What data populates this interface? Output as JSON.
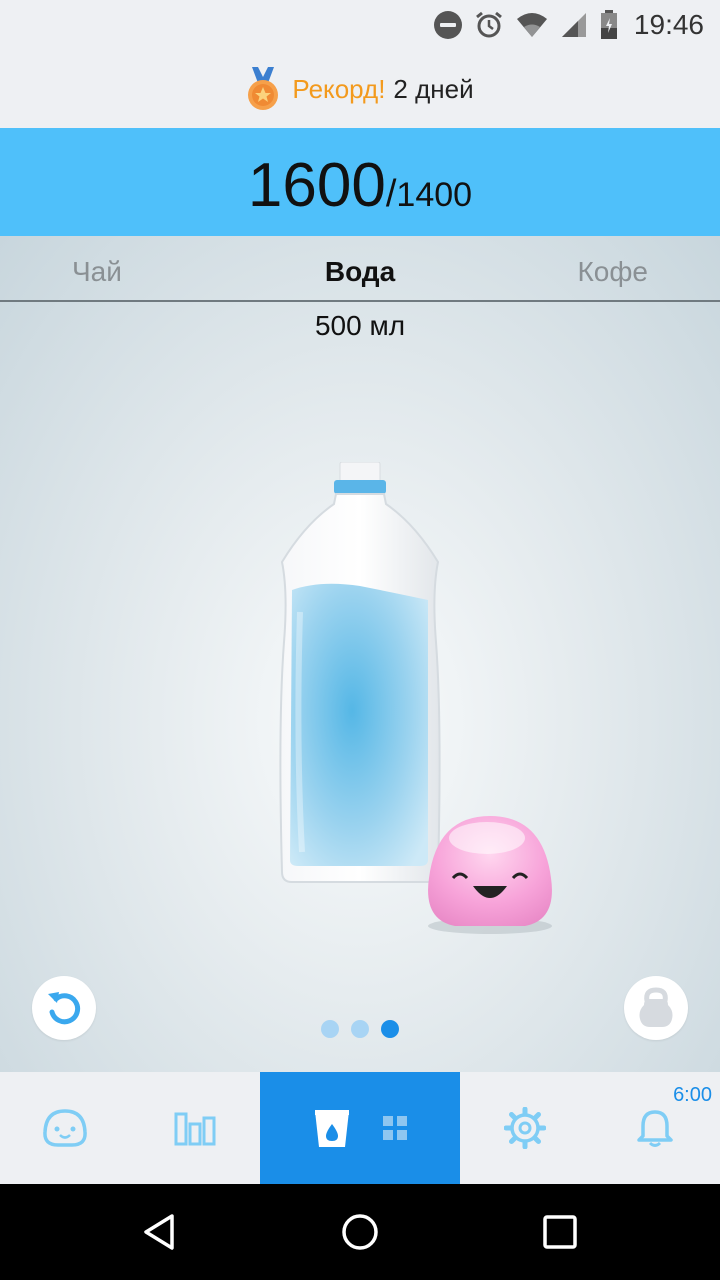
{
  "status_bar": {
    "time": "19:46",
    "icons": [
      "do-not-disturb-icon",
      "alarm-icon",
      "wifi-icon",
      "signal-icon",
      "battery-icon"
    ]
  },
  "record": {
    "label": "Рекорд!",
    "value": "2 дней",
    "icon": "medal-icon"
  },
  "counter": {
    "current": "1600",
    "separator": "/",
    "goal": "1400"
  },
  "tabs": [
    {
      "label": "Чай",
      "active": false
    },
    {
      "label": "Вода",
      "active": true
    },
    {
      "label": "Кофе",
      "active": false
    }
  ],
  "drink": {
    "volume_label": "500 мл"
  },
  "pager": {
    "pages": 3,
    "active_index": 2
  },
  "bottom_nav": {
    "items": [
      "face-icon",
      "stats-icon",
      "drink-icon",
      "settings-icon",
      "bell-icon"
    ],
    "reminder_time": "6:00"
  },
  "colors": {
    "accent": "#1a8ee8",
    "counter_bg": "#4fc0fa",
    "record_label": "#f39a1d",
    "icon_light": "#7fcdf5"
  }
}
